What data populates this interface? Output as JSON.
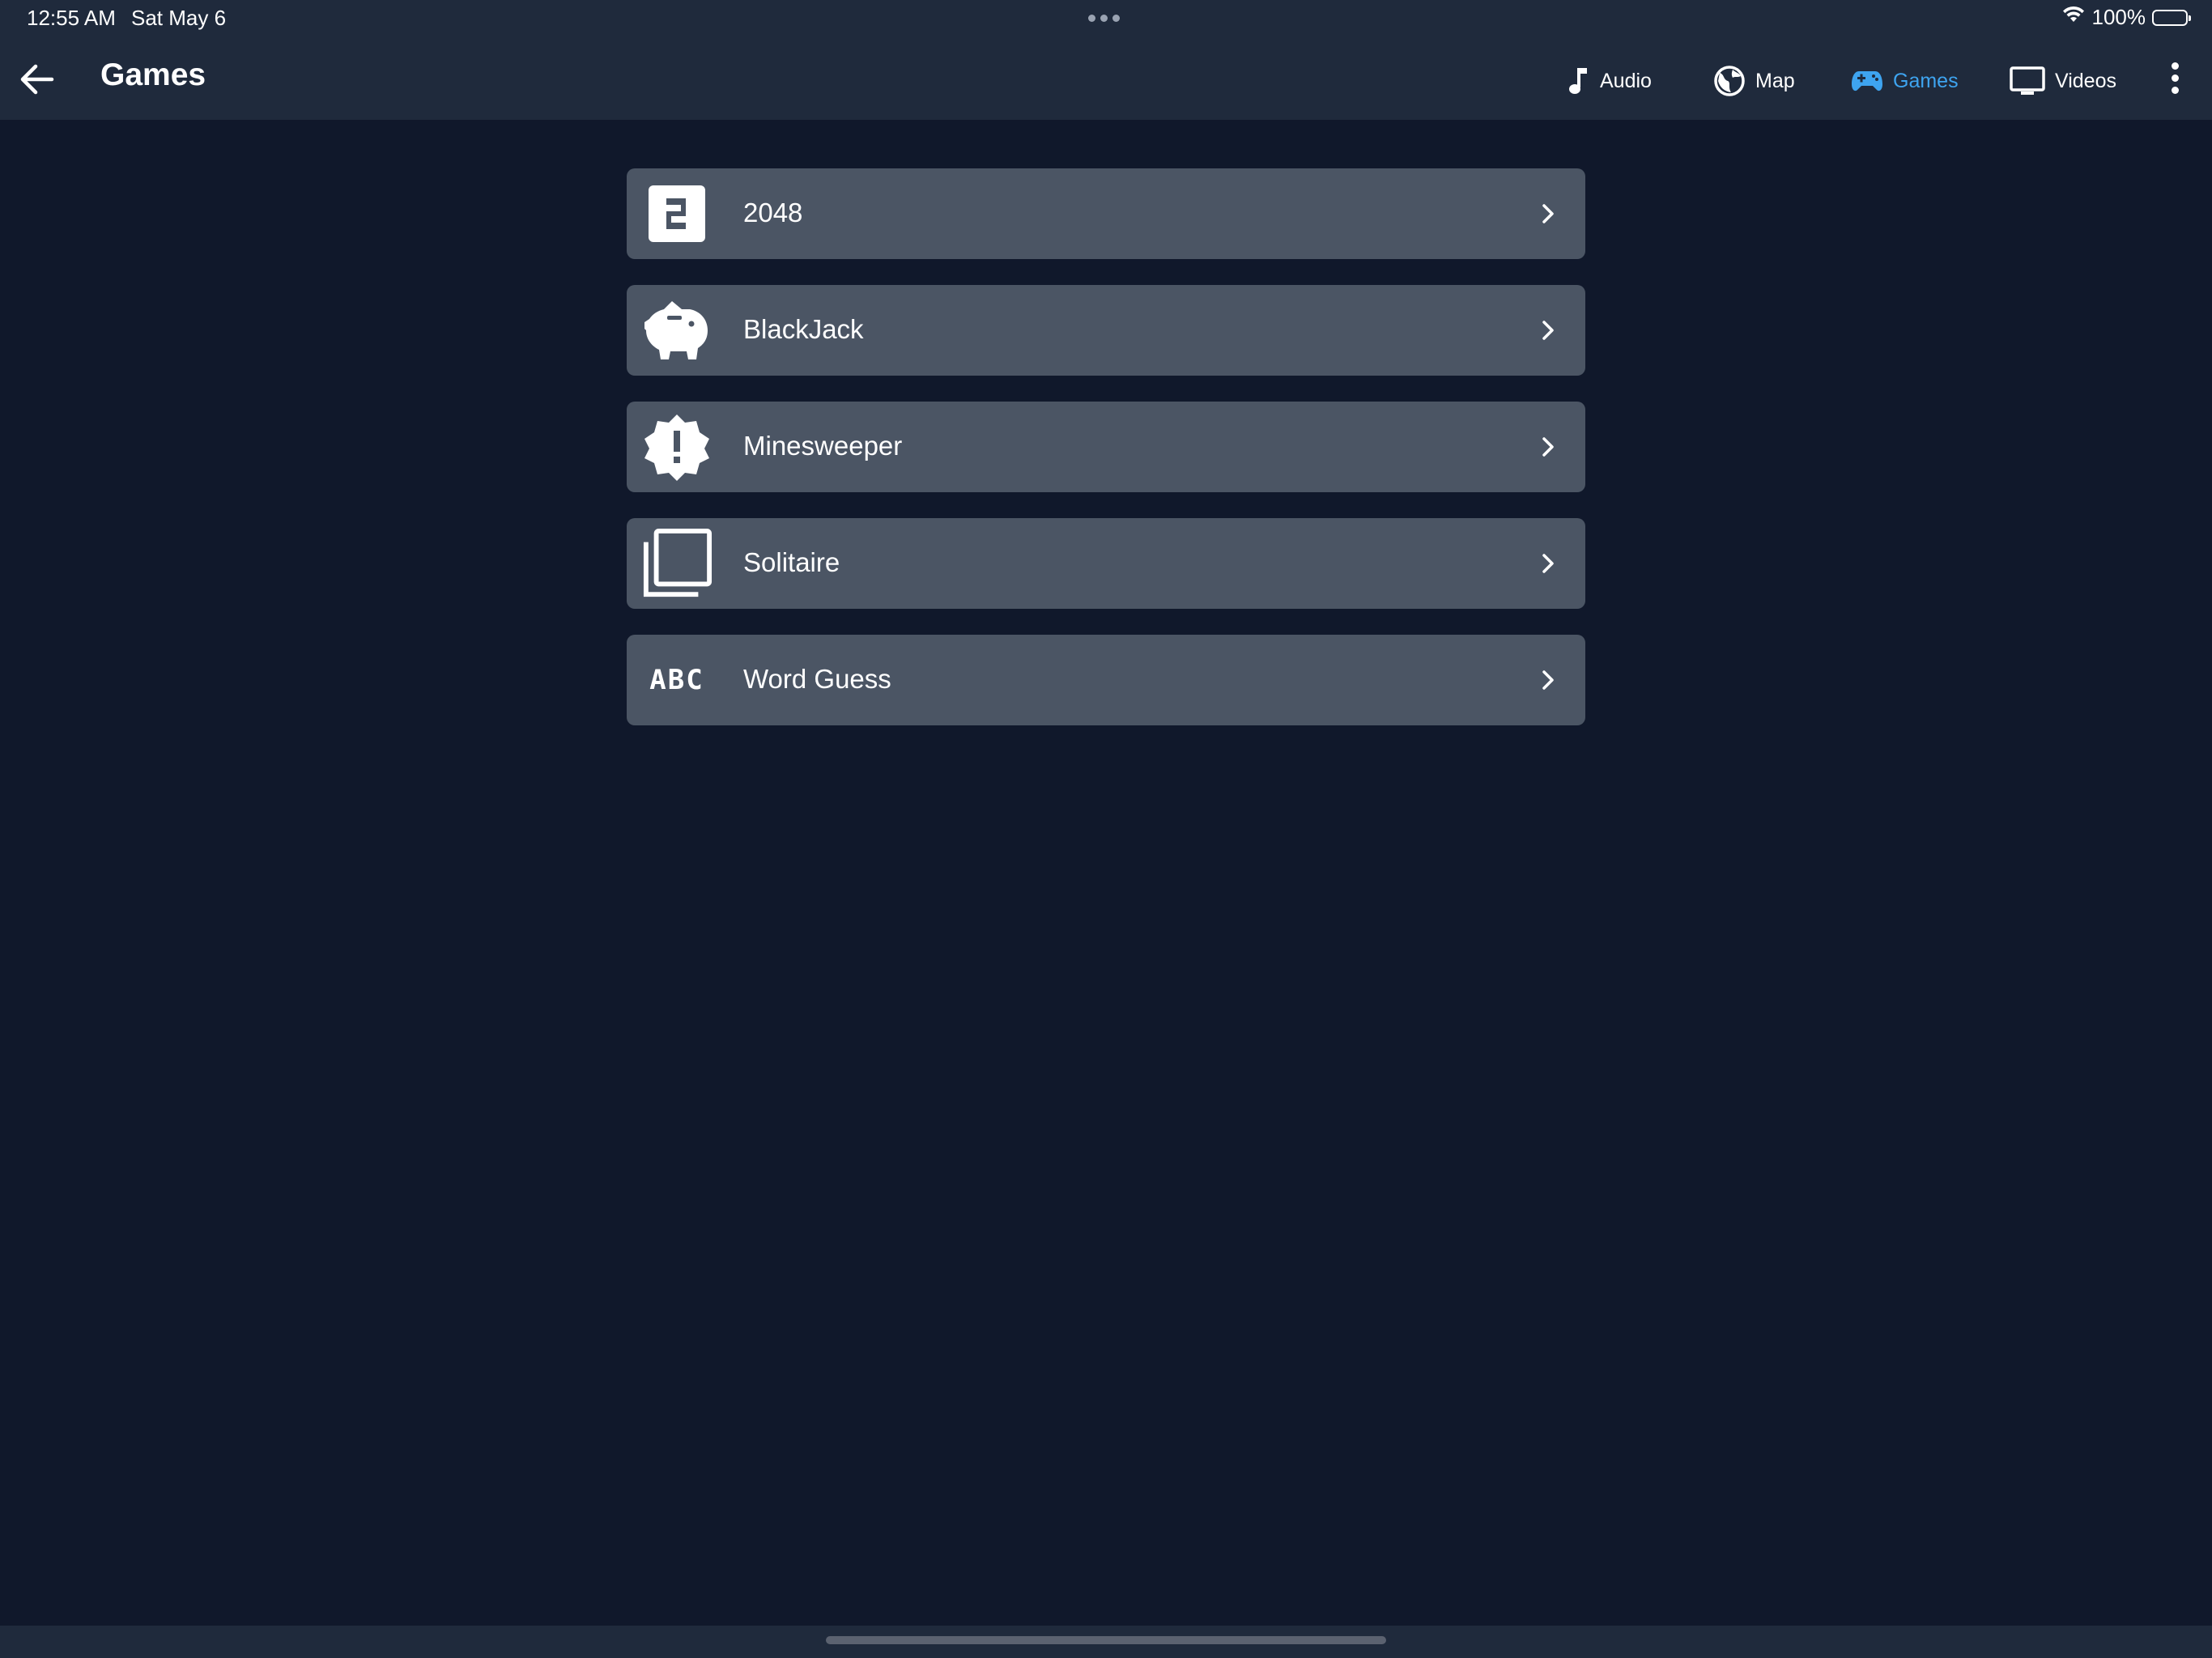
{
  "status_bar": {
    "time": "12:55 AM",
    "date": "Sat May 6",
    "battery": "100%",
    "icons": [
      "wifi-icon",
      "battery-icon"
    ]
  },
  "app_bar": {
    "title": "Games",
    "back_icon": "arrow-left-icon",
    "nav": [
      {
        "label": "Audio",
        "icon": "music-note-icon",
        "active": false
      },
      {
        "label": "Map",
        "icon": "globe-icon",
        "active": false
      },
      {
        "label": "Games",
        "icon": "gamepad-icon",
        "active": true
      },
      {
        "label": "Videos",
        "icon": "monitor-icon",
        "active": false
      }
    ],
    "more_icon": "more-vertical-icon"
  },
  "games": [
    {
      "label": "2048",
      "icon": "numeric-2-box-icon"
    },
    {
      "label": "BlackJack",
      "icon": "piggy-bank-icon"
    },
    {
      "label": "Minesweeper",
      "icon": "alert-decagram-icon"
    },
    {
      "label": "Solitaire",
      "icon": "card-stack-icon",
      "icon_text": ""
    },
    {
      "label": "Word Guess",
      "icon": "abc-icon",
      "icon_text": "ABC"
    }
  ],
  "colors": {
    "background": "#10182b",
    "bar": "#1f2a3c",
    "row": "#4b5564",
    "accent": "#3ea4f0",
    "text": "#ffffff"
  }
}
